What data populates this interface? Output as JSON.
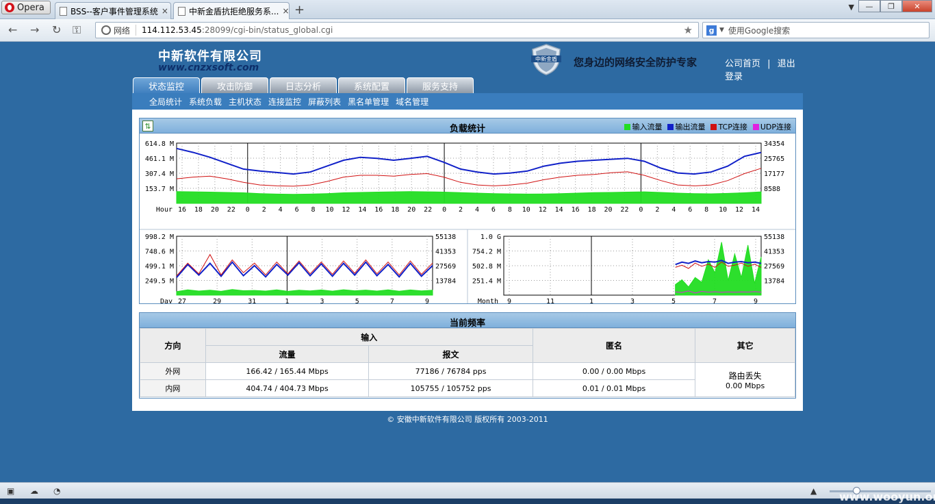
{
  "browser": {
    "opera_label": "Opera",
    "tabs": [
      {
        "title": "BSS--客户事件管理系统",
        "close": "×"
      },
      {
        "title": "中新金盾抗拒绝服务系...",
        "close": "×"
      }
    ],
    "new_tab": "+",
    "address": {
      "net_label": "网络",
      "host": "114.112.53.45",
      "path": ":28099/cgi-bin/status_global.cgi"
    },
    "search_placeholder": "使用Google搜索"
  },
  "header": {
    "company": "中新软件有限公司",
    "url": "www.cnzxsoft.com",
    "slogan": "您身边的网络安全防护专家",
    "links": [
      "公司首页",
      "退出登录"
    ],
    "link_sep": "|"
  },
  "tabs": [
    "状态监控",
    "攻击防御",
    "日志分析",
    "系统配置",
    "服务支持"
  ],
  "subnav": [
    "全局统计",
    "系统负载",
    "主机状态",
    "连接监控",
    "屏蔽列表",
    "黑名单管理",
    "域名管理"
  ],
  "load_panel": {
    "title": "负载统计",
    "legend": [
      {
        "label": "输入流量",
        "color": "#22dd22"
      },
      {
        "label": "输出流量",
        "color": "#1020c8"
      },
      {
        "label": "TCP连接",
        "color": "#d01010"
      },
      {
        "label": "UDP连接",
        "color": "#e020e0"
      }
    ]
  },
  "chart_data": [
    {
      "type": "line",
      "name": "hour",
      "x_label": "Hour",
      "x_ticks": [
        "16",
        "18",
        "20",
        "22",
        "0",
        "2",
        "4",
        "6",
        "8",
        "10",
        "12",
        "14",
        "16",
        "18",
        "20",
        "22",
        "0",
        "2",
        "4",
        "6",
        "8",
        "10",
        "12",
        "14",
        "16",
        "18",
        "20",
        "22",
        "0",
        "2",
        "4",
        "6",
        "8",
        "10",
        "12",
        "14"
      ],
      "y_left": [
        "614.8 M",
        "461.1 M",
        "307.4 M",
        "153.7 M"
      ],
      "y_right": [
        "34354",
        "25765",
        "17177",
        "8588"
      ],
      "series": [
        {
          "name": "输入流量",
          "values": [
            120,
            118,
            115,
            112,
            108,
            100,
            95,
            92,
            95,
            100,
            108,
            112,
            115,
            118,
            120,
            118,
            115,
            110,
            105,
            100,
            97,
            95,
            96,
            100,
            105,
            110,
            112,
            115,
            118,
            112,
            105,
            100,
            98,
            102,
            108,
            118
          ]
        },
        {
          "name": "输出流量",
          "values": [
            560,
            520,
            470,
            410,
            350,
            330,
            315,
            300,
            320,
            380,
            440,
            470,
            460,
            440,
            460,
            480,
            420,
            350,
            320,
            300,
            310,
            330,
            380,
            410,
            430,
            440,
            450,
            460,
            430,
            360,
            310,
            300,
            320,
            380,
            480,
            520
          ]
        },
        {
          "name": "TCP连接",
          "values": [
            14000,
            15000,
            15500,
            14000,
            12000,
            10500,
            10000,
            9800,
            10500,
            12500,
            15000,
            16000,
            16000,
            15500,
            16500,
            17000,
            15000,
            12000,
            10500,
            10000,
            10500,
            11500,
            13500,
            15000,
            16000,
            16500,
            17500,
            18000,
            16000,
            13000,
            10500,
            10000,
            10500,
            13000,
            17000,
            20000
          ]
        }
      ]
    },
    {
      "type": "line",
      "name": "day",
      "x_label": "Day",
      "x_ticks": [
        "27",
        "29",
        "31",
        "1",
        "3",
        "5",
        "7",
        "9"
      ],
      "y_left": [
        "998.2 M",
        "748.6 M",
        "499.1 M",
        "249.5 M"
      ],
      "y_right": [
        "55138",
        "41353",
        "27569",
        "13784"
      ],
      "series": [
        {
          "name": "输入流量",
          "values": [
            60,
            90,
            70,
            85,
            65,
            95,
            75,
            80,
            70,
            90,
            65,
            85,
            72,
            88,
            68,
            92,
            74,
            86,
            70,
            90,
            66,
            88,
            72,
            84
          ]
        },
        {
          "name": "输出流量",
          "values": [
            300,
            520,
            340,
            540,
            320,
            560,
            330,
            500,
            310,
            520,
            340,
            550,
            330,
            530,
            320,
            540,
            340,
            560,
            330,
            520,
            310,
            540,
            320,
            500
          ]
        },
        {
          "name": "TCP连接",
          "values": [
            18000,
            30000,
            20000,
            38000,
            19000,
            33000,
            21000,
            30000,
            19000,
            31000,
            20000,
            32000,
            20000,
            31000,
            19500,
            32000,
            20500,
            33000,
            20000,
            31000,
            19000,
            32000,
            19500,
            30000
          ]
        }
      ]
    },
    {
      "type": "line",
      "name": "month",
      "x_label": "Month",
      "x_ticks": [
        "9",
        "11",
        "1",
        "3",
        "5",
        "7",
        "9"
      ],
      "y_left": [
        "1.0 G",
        "754.2 M",
        "502.8 M",
        "251.4 M"
      ],
      "y_right": [
        "55138",
        "41353",
        "27569",
        "13784"
      ],
      "series": [
        {
          "name": "输入流量",
          "values": [
            null,
            null,
            null,
            null,
            null,
            null,
            null,
            null,
            null,
            null,
            null,
            null,
            null,
            null,
            null,
            null,
            null,
            null,
            null,
            null,
            null,
            null,
            null,
            null,
            null,
            null,
            180,
            260,
            140,
            300,
            220,
            600,
            380,
            900,
            250,
            700,
            300,
            850,
            200,
            650
          ]
        },
        {
          "name": "输出流量",
          "values": [
            null,
            null,
            null,
            null,
            null,
            null,
            null,
            null,
            null,
            null,
            null,
            null,
            null,
            null,
            null,
            null,
            null,
            null,
            null,
            null,
            null,
            null,
            null,
            null,
            null,
            null,
            520,
            560,
            540,
            580,
            550,
            570,
            560,
            590,
            540,
            560,
            570,
            550,
            560,
            540
          ]
        },
        {
          "name": "TCP连接",
          "values": [
            null,
            null,
            null,
            null,
            null,
            null,
            null,
            null,
            null,
            null,
            null,
            null,
            null,
            null,
            null,
            null,
            null,
            null,
            null,
            null,
            null,
            null,
            null,
            null,
            null,
            null,
            26000,
            28000,
            25000,
            30000,
            27000,
            29000,
            26000,
            31000,
            27000,
            28000,
            30000,
            27000,
            29000,
            26000
          ]
        },
        {
          "name": "UDP连接",
          "values": [
            null,
            null,
            null,
            null,
            null,
            null,
            null,
            null,
            null,
            null,
            null,
            null,
            null,
            null,
            null,
            null,
            null,
            null,
            null,
            null,
            null,
            null,
            null,
            null,
            null,
            null,
            3000,
            2500,
            4000,
            2000,
            3500,
            2800,
            3200,
            2600,
            3000,
            2700,
            3100,
            2900,
            3300,
            2800
          ]
        }
      ]
    }
  ],
  "freq_panel": {
    "title": "当前频率",
    "headers": {
      "direction": "方向",
      "input": "输入",
      "traffic": "流量",
      "packets": "报文",
      "anon": "匿名",
      "other": "其它"
    },
    "rows": [
      {
        "dir": "外网",
        "traffic": "166.42 / 165.44 Mbps",
        "packets": "77186 / 76784 pps",
        "anon": "0.00 / 0.00 Mbps"
      },
      {
        "dir": "内网",
        "traffic": "404.74 / 404.73 Mbps",
        "packets": "105755 / 105752 pps",
        "anon": "0.01 / 0.01 Mbps"
      }
    ],
    "other_line1": "路由丢失",
    "other_line2": "0.00 Mbps"
  },
  "footer": "© 安徽中新软件有限公司  版权所有  2003-2011",
  "watermark": "www.wooyun.org"
}
